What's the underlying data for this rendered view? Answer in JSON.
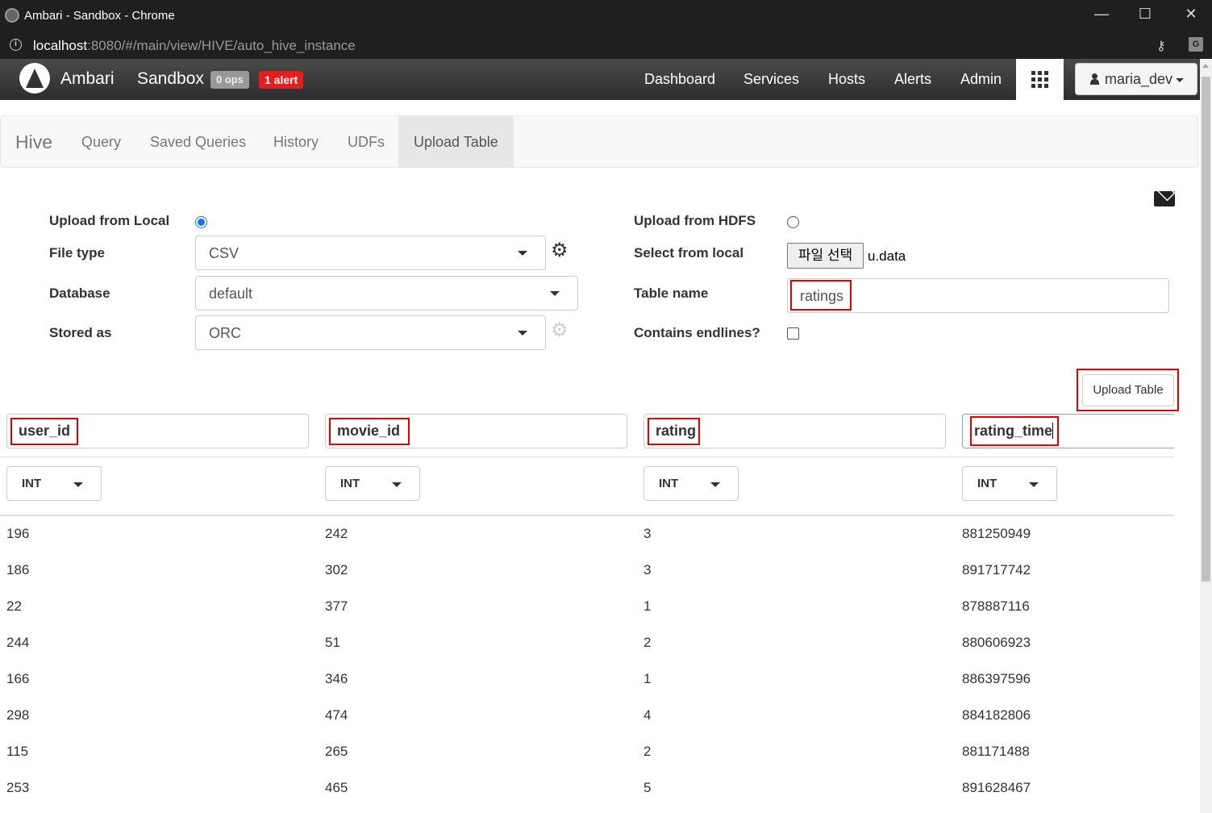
{
  "window": {
    "title": "Ambari - Sandbox - Chrome",
    "minimize": "—",
    "maximize": "☐",
    "close": "✕"
  },
  "browser": {
    "url_host": "localhost",
    "url_path": ":8080/#/main/view/HIVE/auto_hive_instance",
    "info_icon": "i",
    "key_icon": "⚷",
    "translate_icon": "G"
  },
  "navbar": {
    "brand": "Ambari",
    "cluster": "Sandbox",
    "ops": "0 ops",
    "alerts": "1 alert",
    "links": [
      "Dashboard",
      "Services",
      "Hosts",
      "Alerts",
      "Admin"
    ],
    "user": "maria_dev"
  },
  "hive": {
    "brand": "Hive",
    "tabs": [
      "Query",
      "Saved Queries",
      "History",
      "UDFs",
      "Upload Table"
    ],
    "active_tab": "Upload Table"
  },
  "form": {
    "upload_local_label": "Upload from Local",
    "upload_local_selected": true,
    "file_type_label": "File type",
    "file_type": "CSV",
    "database_label": "Database",
    "database": "default",
    "stored_as_label": "Stored as",
    "stored_as": "ORC",
    "upload_hdfs_label": "Upload from HDFS",
    "upload_hdfs_selected": false,
    "select_local_label": "Select from local",
    "file_button": "파일 선택",
    "file_name": "u.data",
    "table_name_label": "Table name",
    "table_name": "ratings",
    "endlines_label": "Contains endlines?",
    "endlines_checked": false,
    "upload_button": "Upload Table"
  },
  "table": {
    "columns": [
      {
        "name": "user_id",
        "type": "INT"
      },
      {
        "name": "movie_id",
        "type": "INT"
      },
      {
        "name": "rating",
        "type": "INT"
      },
      {
        "name": "rating_time",
        "type": "INT"
      }
    ],
    "rows": [
      [
        "196",
        "242",
        "3",
        "881250949"
      ],
      [
        "186",
        "302",
        "3",
        "891717742"
      ],
      [
        "22",
        "377",
        "1",
        "878887116"
      ],
      [
        "244",
        "51",
        "2",
        "880606923"
      ],
      [
        "166",
        "346",
        "1",
        "886397596"
      ],
      [
        "298",
        "474",
        "4",
        "884182806"
      ],
      [
        "115",
        "265",
        "2",
        "881171488"
      ],
      [
        "253",
        "465",
        "5",
        "891628467"
      ]
    ]
  },
  "colors": {
    "highlight": "#e50000",
    "alert_badge": "#e41d1d",
    "radio_selected": "#1a73e8"
  }
}
